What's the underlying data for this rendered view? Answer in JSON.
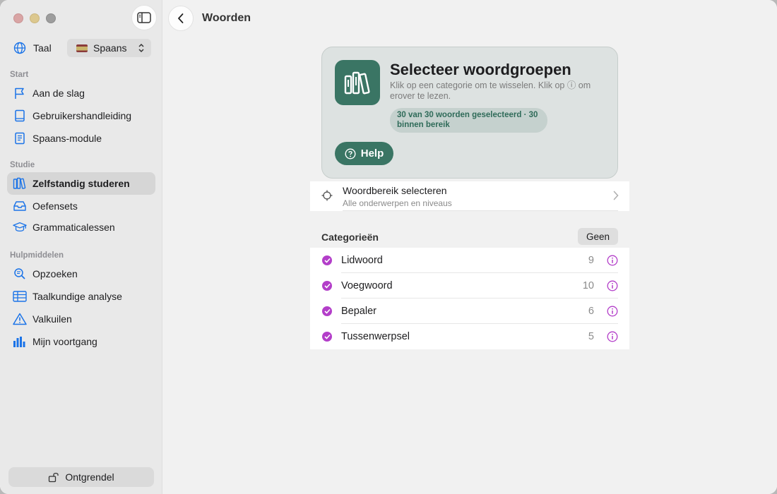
{
  "window": {
    "controls": [
      "close",
      "minimize",
      "zoom"
    ]
  },
  "sidebar": {
    "toggle_icon": "sidebar-toggle-icon",
    "language": {
      "icon": "globe-icon",
      "label": "Taal",
      "selected": "Spaans"
    },
    "sections": [
      {
        "title": "Start",
        "items": [
          {
            "label": "Aan de slag",
            "icon": "flag-icon"
          },
          {
            "label": "Gebruikershandleiding",
            "icon": "book-icon"
          },
          {
            "label": "Spaans-module",
            "icon": "document-icon"
          }
        ]
      },
      {
        "title": "Studie",
        "items": [
          {
            "label": "Zelfstandig studeren",
            "icon": "books-icon",
            "active": true
          },
          {
            "label": "Oefensets",
            "icon": "tray-icon"
          },
          {
            "label": "Grammaticalessen",
            "icon": "graduation-cap-icon"
          }
        ]
      },
      {
        "title": "Hulpmiddelen",
        "items": [
          {
            "label": "Opzoeken",
            "icon": "magnifier-icon"
          },
          {
            "label": "Taalkundige analyse",
            "icon": "table-icon"
          },
          {
            "label": "Valkuilen",
            "icon": "warning-icon"
          },
          {
            "label": "Mijn voortgang",
            "icon": "bar-chart-icon"
          }
        ]
      }
    ],
    "unlock_label": "Ontgrendel"
  },
  "header": {
    "back_icon": "chevron-left-icon",
    "title": "Woorden"
  },
  "hero": {
    "title": "Selecteer woordgroepen",
    "subtitle": "Klik op een categorie om te wisselen. Klik op ⓘ om erover te lezen.",
    "badge": "30 van 30 woorden geselecteerd · 30 binnen bereik",
    "help_label": "Help",
    "accent": "#3a7564"
  },
  "range": {
    "title": "Woordbereik selecteren",
    "subtitle": "Alle onderwerpen en niveaus"
  },
  "categories": {
    "header": "Categorieën",
    "none_label": "Geen",
    "check_color": "#b33ec9",
    "items": [
      {
        "name": "Lidwoord",
        "count": "9"
      },
      {
        "name": "Voegwoord",
        "count": "10"
      },
      {
        "name": "Bepaler",
        "count": "6"
      },
      {
        "name": "Tussenwerpsel",
        "count": "5"
      }
    ]
  }
}
